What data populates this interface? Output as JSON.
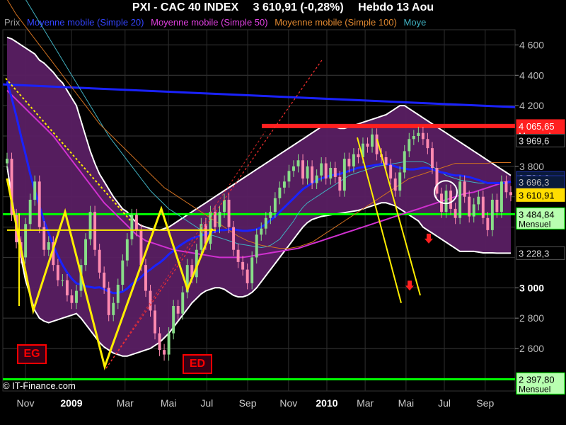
{
  "header": {
    "symbol": "PXI - CAC 40 INDEX",
    "last": "3 610,91 (-0,28%)",
    "period": "Hebdo  13 Aou"
  },
  "legend": {
    "price": "Prix",
    "ma20": "Moyenne mobile (Simple 20)",
    "ma50": "Moyenne mobile (Simple 50)",
    "ma100": "Moyenne mobile (Simple 100)",
    "ma_more": "Moye"
  },
  "copyright": "© IT-Finance.com",
  "annotations": {
    "left_pattern": "EG",
    "right_pattern": "ED"
  },
  "colors": {
    "background": "#000000",
    "band_fill": "#5a1f63",
    "candle_up": "#88dd88",
    "candle_down": "#ff8ab0",
    "ma20": "#1a22ff",
    "ma50": "#d030d0",
    "ma100": "#d07020",
    "ma_long": "#40b0c0",
    "bollinger": "#ffffff",
    "resistance": "#ff2020",
    "support": "#00ff00",
    "pattern": "#ffee00"
  },
  "chart_data": {
    "type": "candlestick",
    "instrument": "CAC 40 INDEX",
    "timeframe": "weekly",
    "x_ticks": [
      "Nov",
      "2009",
      "Mar",
      "Mai",
      "Jul",
      "Sep",
      "Nov",
      "2010",
      "Mar",
      "Mai",
      "Jul",
      "Sep"
    ],
    "y_ticks": [
      "4 600",
      "4 400",
      "4 200",
      "3 800",
      "3 000",
      "2 800",
      "2 600"
    ],
    "ylim": [
      2320,
      4700
    ],
    "price_labels": [
      {
        "text": "4 065,65",
        "sub": "Mensuel",
        "value": 4065.65,
        "kind": "resistance"
      },
      {
        "text": "3 969,6",
        "value": 3969.6,
        "kind": "plain"
      },
      {
        "text": "3 724,6",
        "value": 3724.6,
        "kind": "ma"
      },
      {
        "text": "3 696,3",
        "value": 3696.3,
        "kind": "ma"
      },
      {
        "text": "3 610,91",
        "value": 3610.91,
        "kind": "last"
      },
      {
        "text": "3 484,84",
        "sub": "Mensuel",
        "value": 3484.84,
        "kind": "support"
      },
      {
        "text": "3 228,3",
        "value": 3228.3,
        "kind": "plain"
      },
      {
        "text": "2 397,80",
        "sub": "Mensuel",
        "value": 2397.8,
        "kind": "support"
      }
    ],
    "resistance_level": 4065.65,
    "support_levels": [
      3484.84,
      2397.8
    ],
    "last_close": 3610.91,
    "closes": [
      3850,
      3480,
      3300,
      3200,
      3420,
      3580,
      3700,
      3400,
      3250,
      3300,
      3150,
      3050,
      3050,
      2950,
      2900,
      2980,
      3150,
      3320,
      3500,
      3250,
      3100,
      3000,
      2820,
      2900,
      3020,
      3180,
      3320,
      3480,
      3380,
      3150,
      2980,
      2850,
      2700,
      2590,
      2560,
      2700,
      2880,
      2830,
      2970,
      3150,
      3070,
      3250,
      3420,
      3290,
      3500,
      3400,
      3500,
      3580,
      3400,
      3250,
      3170,
      3120,
      3030,
      3200,
      3350,
      3390,
      3460,
      3500,
      3590,
      3660,
      3700,
      3770,
      3800,
      3840,
      3720,
      3800,
      3690,
      3740,
      3820,
      3720,
      3790,
      3730,
      3640,
      3850,
      3800,
      3880,
      3860,
      3950,
      3930,
      4010,
      3880,
      3860,
      3810,
      3720,
      3640,
      3760,
      3900,
      3980,
      4000,
      4020,
      3980,
      3920,
      3790,
      3620,
      3500,
      3640,
      3520,
      3460,
      3700,
      3600,
      3470,
      3550,
      3600,
      3460,
      3380,
      3580,
      3500,
      3700,
      3630,
      3610
    ],
    "ma20": [
      4360,
      4250,
      4130,
      4000,
      3880,
      3750,
      3640,
      3540,
      3440,
      3360,
      3280,
      3210,
      3150,
      3100,
      3060,
      3030,
      3020,
      3010,
      3005,
      3000,
      3003,
      2990,
      2975,
      2965,
      2965,
      2975,
      2995,
      3025,
      3045,
      3070,
      3100,
      3120,
      3145,
      3165,
      3190,
      3220,
      3245,
      3270,
      3290,
      3310,
      3325,
      3335,
      3345,
      3355,
      3360,
      3370,
      3380,
      3380,
      3385,
      3385,
      3380,
      3375,
      3375,
      3380,
      3385,
      3400,
      3420,
      3445,
      3470,
      3500,
      3530,
      3560,
      3590,
      3620,
      3650,
      3670,
      3690,
      3710,
      3720,
      3730,
      3740,
      3745,
      3750,
      3760,
      3770,
      3780,
      3790,
      3795,
      3800,
      3805,
      3810,
      3815,
      3815,
      3810,
      3800,
      3790,
      3785,
      3780,
      3780,
      3785,
      3790,
      3790,
      3780,
      3770,
      3760,
      3755,
      3745,
      3740,
      3740,
      3735,
      3730,
      3720,
      3710,
      3700,
      3690,
      3690,
      3690,
      3690,
      3690,
      3700
    ],
    "ma50": [
      4300,
      4270,
      4240,
      4210,
      4180,
      4150,
      4120,
      4090,
      4060,
      4030,
      4000,
      3960,
      3920,
      3880,
      3840,
      3800,
      3760,
      3720,
      3680,
      3640,
      3600,
      3560,
      3530,
      3500,
      3470,
      3440,
      3410,
      3380,
      3350,
      3330,
      3310,
      3300,
      3290,
      3280,
      3270,
      3260,
      3250,
      3245,
      3240,
      3235,
      3230,
      3225,
      3220,
      3215,
      3210,
      3205,
      3200,
      3200,
      3200,
      3200,
      3200,
      3200,
      3205,
      3210,
      3215,
      3220,
      3225,
      3230,
      3235,
      3240,
      3245,
      3250,
      3255,
      3260,
      3270,
      3280,
      3290,
      3300,
      3310,
      3320,
      3330,
      3340,
      3350,
      3360,
      3370,
      3380,
      3390,
      3400,
      3410,
      3420,
      3430,
      3440,
      3450,
      3460,
      3470,
      3480,
      3490,
      3500,
      3510,
      3520,
      3530,
      3540,
      3550,
      3560,
      3570,
      3580,
      3590,
      3600,
      3610,
      3620,
      3625,
      3630,
      3640,
      3650,
      3660,
      3670,
      3680,
      3690,
      3700,
      3700
    ],
    "ma100": [
      4900,
      4850,
      4800,
      4760,
      4720,
      4680,
      4640,
      4600,
      4560,
      4520,
      4480,
      4440,
      4400,
      4360,
      4320,
      4280,
      4240,
      4200,
      4160,
      4120,
      4080,
      4050,
      4020,
      3990,
      3960,
      3930,
      3900,
      3870,
      3840,
      3810,
      3780,
      3750,
      3720,
      3690,
      3660,
      3640,
      3620,
      3600,
      3580,
      3560,
      3540,
      3520,
      3500,
      3480,
      3460,
      3440,
      3420,
      3400,
      3380,
      3360,
      3340,
      3325,
      3310,
      3300,
      3290,
      3280,
      3275,
      3270,
      3265,
      3260,
      3260,
      3260,
      3265,
      3270,
      3280,
      3290,
      3300,
      3320,
      3340,
      3360,
      3380,
      3400,
      3420,
      3440,
      3460,
      3480,
      3500,
      3520,
      3540,
      3560,
      3580,
      3600,
      3620,
      3640,
      3660,
      3680,
      3700,
      3720,
      3730,
      3740,
      3750,
      3760,
      3770,
      3780,
      3790,
      3800,
      3810,
      3820,
      3820,
      3820,
      3820,
      3820,
      3820,
      3820,
      3820,
      3825,
      3825,
      3825,
      3825,
      3825
    ],
    "ma_long": [
      5200,
      5100,
      5000,
      4950,
      4900,
      4850,
      4800,
      4750,
      4700,
      4650,
      4600,
      4550,
      4500,
      4450,
      4400,
      4350,
      4300,
      4250,
      4200,
      4150,
      4100,
      4050,
      4000,
      3960,
      3920,
      3880,
      3840,
      3800,
      3760,
      3720,
      3680,
      3640,
      3610,
      3580,
      3550,
      3520,
      3500,
      3480,
      3460,
      3440,
      3420,
      3400,
      3380,
      3360,
      3350,
      3340,
      3330,
      3320,
      3310,
      3300,
      3290,
      3285,
      3280,
      3275,
      3270,
      3265,
      3270,
      3280,
      3300,
      3320,
      3360,
      3400,
      3440,
      3490,
      3530,
      3560,
      3580,
      3600,
      3620,
      3640,
      3660,
      3680,
      3700,
      3720,
      3740,
      3750,
      3760,
      3770,
      3780,
      3790,
      3800,
      3805,
      3810,
      3815,
      3820,
      3825,
      3830,
      3830,
      3830,
      3830,
      3830,
      3820,
      3800,
      3780,
      3760,
      3740,
      3730,
      3720,
      3710,
      3705,
      3700,
      3695,
      3690,
      3690,
      3690,
      3690,
      3690,
      3690,
      3690,
      3696
    ],
    "bollinger_upper": [
      4650,
      4640,
      4620,
      4600,
      4580,
      4560,
      4540,
      4500,
      4480,
      4450,
      4420,
      4380,
      4350,
      4300,
      4250,
      4200,
      4100,
      4000,
      3900,
      3820,
      3750,
      3700,
      3650,
      3600,
      3560,
      3520,
      3500,
      3460,
      3430,
      3410,
      3400,
      3390,
      3385,
      3380,
      3390,
      3400,
      3420,
      3440,
      3460,
      3480,
      3500,
      3520,
      3540,
      3560,
      3580,
      3600,
      3620,
      3640,
      3660,
      3680,
      3700,
      3720,
      3740,
      3760,
      3780,
      3800,
      3820,
      3840,
      3860,
      3880,
      3900,
      3920,
      3940,
      3960,
      3980,
      4000,
      4020,
      4040,
      4060,
      4070,
      4070,
      4060,
      4050,
      4050,
      4060,
      4070,
      4080,
      4090,
      4100,
      4110,
      4120,
      4130,
      4140,
      4160,
      4180,
      4200,
      4200,
      4180,
      4160,
      4140,
      4120,
      4100,
      4080,
      4060,
      4040,
      4020,
      4000,
      3980,
      3960,
      3940,
      3920,
      3900,
      3880,
      3860,
      3840,
      3820,
      3800,
      3780,
      3760,
      3740
    ],
    "bollinger_lower": [
      3800,
      3600,
      3400,
      3200,
      3050,
      2950,
      2850,
      2800,
      2780,
      2770,
      2780,
      2790,
      2800,
      2810,
      2820,
      2830,
      2800,
      2760,
      2720,
      2680,
      2640,
      2610,
      2590,
      2570,
      2560,
      2550,
      2550,
      2560,
      2570,
      2580,
      2590,
      2600,
      2620,
      2640,
      2670,
      2700,
      2740,
      2780,
      2820,
      2860,
      2900,
      2930,
      2960,
      2980,
      2990,
      3000,
      3000,
      2990,
      2970,
      2950,
      2940,
      2940,
      2950,
      2970,
      3000,
      3040,
      3080,
      3120,
      3160,
      3200,
      3240,
      3280,
      3320,
      3360,
      3400,
      3430,
      3450,
      3460,
      3470,
      3475,
      3480,
      3485,
      3490,
      3495,
      3500,
      3505,
      3510,
      3520,
      3530,
      3540,
      3550,
      3560,
      3560,
      3550,
      3540,
      3520,
      3500,
      3480,
      3460,
      3440,
      3400,
      3380,
      3360,
      3340,
      3320,
      3300,
      3280,
      3260,
      3240,
      3240,
      3240,
      3240,
      3235,
      3230,
      3230,
      3230,
      3228,
      3228,
      3228,
      3228
    ]
  }
}
